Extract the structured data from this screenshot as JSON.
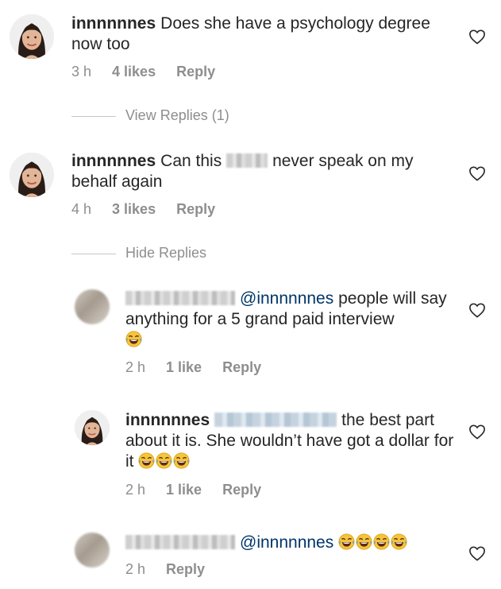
{
  "icons": {
    "heart": "heart-icon",
    "emoji": "face-with-tears-of-joy"
  },
  "colors": {
    "text": "#262626",
    "meta": "#8e8e8e",
    "mention": "#003569"
  },
  "comments": [
    {
      "username": "innnnnnes",
      "text": "Does she have a psychology degree now too",
      "time": "3 h",
      "likes": "4 likes",
      "reply": "Reply"
    },
    {
      "username": "innnnnnes",
      "text_before": "Can this",
      "text_after": "never speak on my behalf again",
      "time": "4 h",
      "likes": "3 likes",
      "reply": "Reply"
    }
  ],
  "view_replies": "View Replies (1)",
  "hide_replies": "Hide Replies",
  "replies": [
    {
      "mention": "@innnnnnes",
      "text": "people will say anything for a 5 grand paid interview",
      "emoji_count": 1,
      "time": "2 h",
      "likes": "1 like",
      "reply": "Reply"
    },
    {
      "username": "innnnnnes",
      "text": "the best part about it is. She wouldn’t have got a dollar for it",
      "emoji_count": 3,
      "time": "2 h",
      "likes": "1 like",
      "reply": "Reply"
    },
    {
      "mention": "@innnnnnes",
      "emoji_count": 4,
      "time": "2 h",
      "reply": "Reply"
    }
  ]
}
